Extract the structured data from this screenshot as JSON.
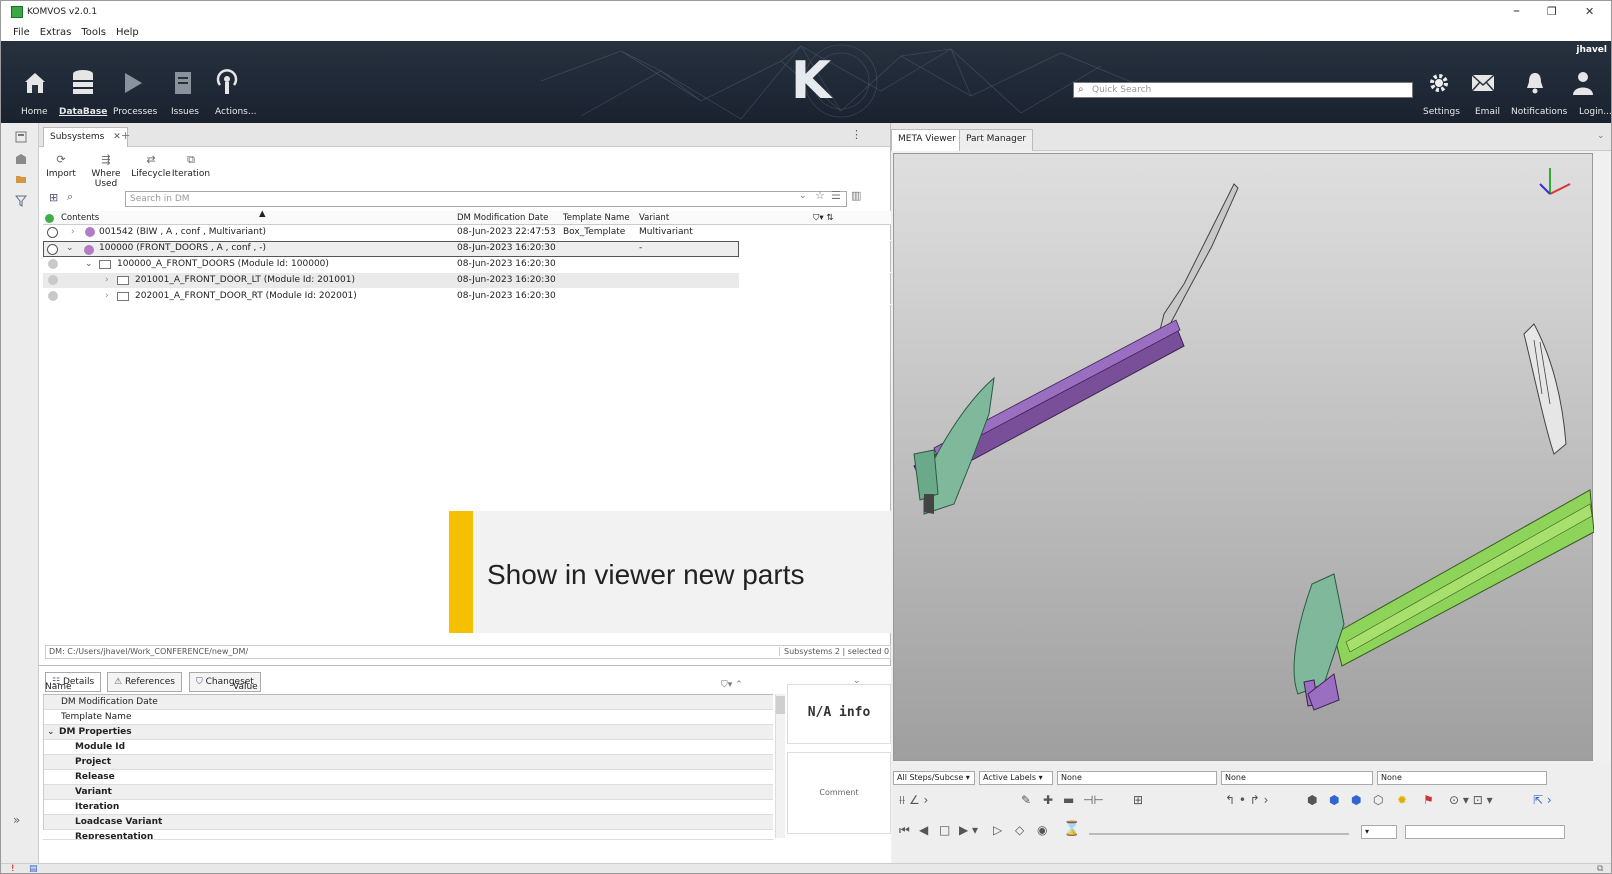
{
  "window": {
    "title": "KOMVOS v2.0.1",
    "controls": [
      "–",
      "❐",
      "✕"
    ]
  },
  "menu": [
    "File",
    "Extras",
    "Tools",
    "Help"
  ],
  "ribbon": {
    "items": [
      {
        "label": "Home",
        "icon": "home-icon"
      },
      {
        "label": "DataBase",
        "icon": "database-icon",
        "active": true
      },
      {
        "label": "Processes",
        "icon": "play-icon"
      },
      {
        "label": "Issues",
        "icon": "issues-icon"
      },
      {
        "label": "Actions...",
        "icon": "broadcast-icon"
      }
    ],
    "quick_search_placeholder": "Quick Search",
    "right_items": [
      {
        "label": "Settings",
        "icon": "gear-icon"
      },
      {
        "label": "Email",
        "icon": "envelope-icon"
      },
      {
        "label": "Notifications",
        "icon": "bell-icon"
      },
      {
        "label": "Login...",
        "icon": "user-icon"
      }
    ],
    "user": "jhavel",
    "logo_text": "K"
  },
  "left_panel": {
    "tab": "Subsystems",
    "toolbar": [
      {
        "label": "Import",
        "icon": "import-icon"
      },
      {
        "label": "Where Used",
        "icon": "where-used-icon"
      },
      {
        "label": "Lifecycle",
        "icon": "lifecycle-icon"
      },
      {
        "label": "Iteration",
        "icon": "iteration-icon"
      }
    ],
    "search_placeholder": "Search in DM",
    "columns": [
      "Contents",
      "DM Modification Date",
      "Template Name",
      "Variant"
    ],
    "rows": [
      {
        "text": "001542 (BIW , A , conf , Multivariant)",
        "date": "08-Jun-2023 22:47:53",
        "template": "Box_Template",
        "variant": "Multivariant",
        "indent": 0,
        "arrow": "›",
        "icon": "purple-dot"
      },
      {
        "text": "100000 (FRONT_DOORS , A , conf , -)",
        "date": "08-Jun-2023 16:20:30",
        "template": "",
        "variant": "-",
        "indent": 0,
        "arrow": "⌄",
        "icon": "purple-dot",
        "selected": true
      },
      {
        "text": "100000_A_FRONT_DOORS (Module Id: 100000)",
        "date": "08-Jun-2023 16:20:30",
        "template": "",
        "variant": "",
        "indent": 1,
        "arrow": "⌄",
        "icon": "folder"
      },
      {
        "text": "201001_A_FRONT_DOOR_LT (Module Id: 201001)",
        "date": "08-Jun-2023 16:20:30",
        "template": "",
        "variant": "",
        "indent": 2,
        "arrow": "›",
        "icon": "folder",
        "alt": true
      },
      {
        "text": "202001_A_FRONT_DOOR_RT (Module Id: 202001)",
        "date": "08-Jun-2023 16:20:30",
        "template": "",
        "variant": "",
        "indent": 2,
        "arrow": "›",
        "icon": "folder"
      }
    ],
    "path": "DM: C:/Users/jhavel/Work_CONFERENCE/new_DM/",
    "path_right": "Subsystems 2 | selected 0"
  },
  "callout": "Show in viewer new parts",
  "bottom_panel": {
    "tabs": [
      "Details",
      "References",
      "Changeset"
    ],
    "columns": [
      "Name",
      "Value"
    ],
    "rows": [
      {
        "name": "DM Modification Date",
        "level": 1
      },
      {
        "name": "Template Name",
        "level": 1
      },
      {
        "name": "DM Properties",
        "level": 0,
        "bold": true,
        "arrow": "⌄"
      },
      {
        "name": "Module Id",
        "level": 2,
        "bold": true
      },
      {
        "name": "Project",
        "level": 2,
        "bold": true
      },
      {
        "name": "Release",
        "level": 2,
        "bold": true
      },
      {
        "name": "Variant",
        "level": 2,
        "bold": true
      },
      {
        "name": "Iteration",
        "level": 2,
        "bold": true
      },
      {
        "name": "Loadcase Variant",
        "level": 2,
        "bold": true
      },
      {
        "name": "Representation",
        "level": 2,
        "bold": true
      }
    ],
    "info_card": "N/A info",
    "comment_card": "Comment"
  },
  "right_panel": {
    "tabs": [
      "META Viewer",
      "Part Manager"
    ],
    "selects": [
      "All Steps/Subcse",
      "Active Labels",
      "None",
      "None",
      "None"
    ]
  },
  "colors": {
    "accent": "#f5c000",
    "ribbon": "#1f2835",
    "part_green": "#8ed35a",
    "part_purple": "#7a4f9a",
    "part_teal": "#7fb89a"
  }
}
